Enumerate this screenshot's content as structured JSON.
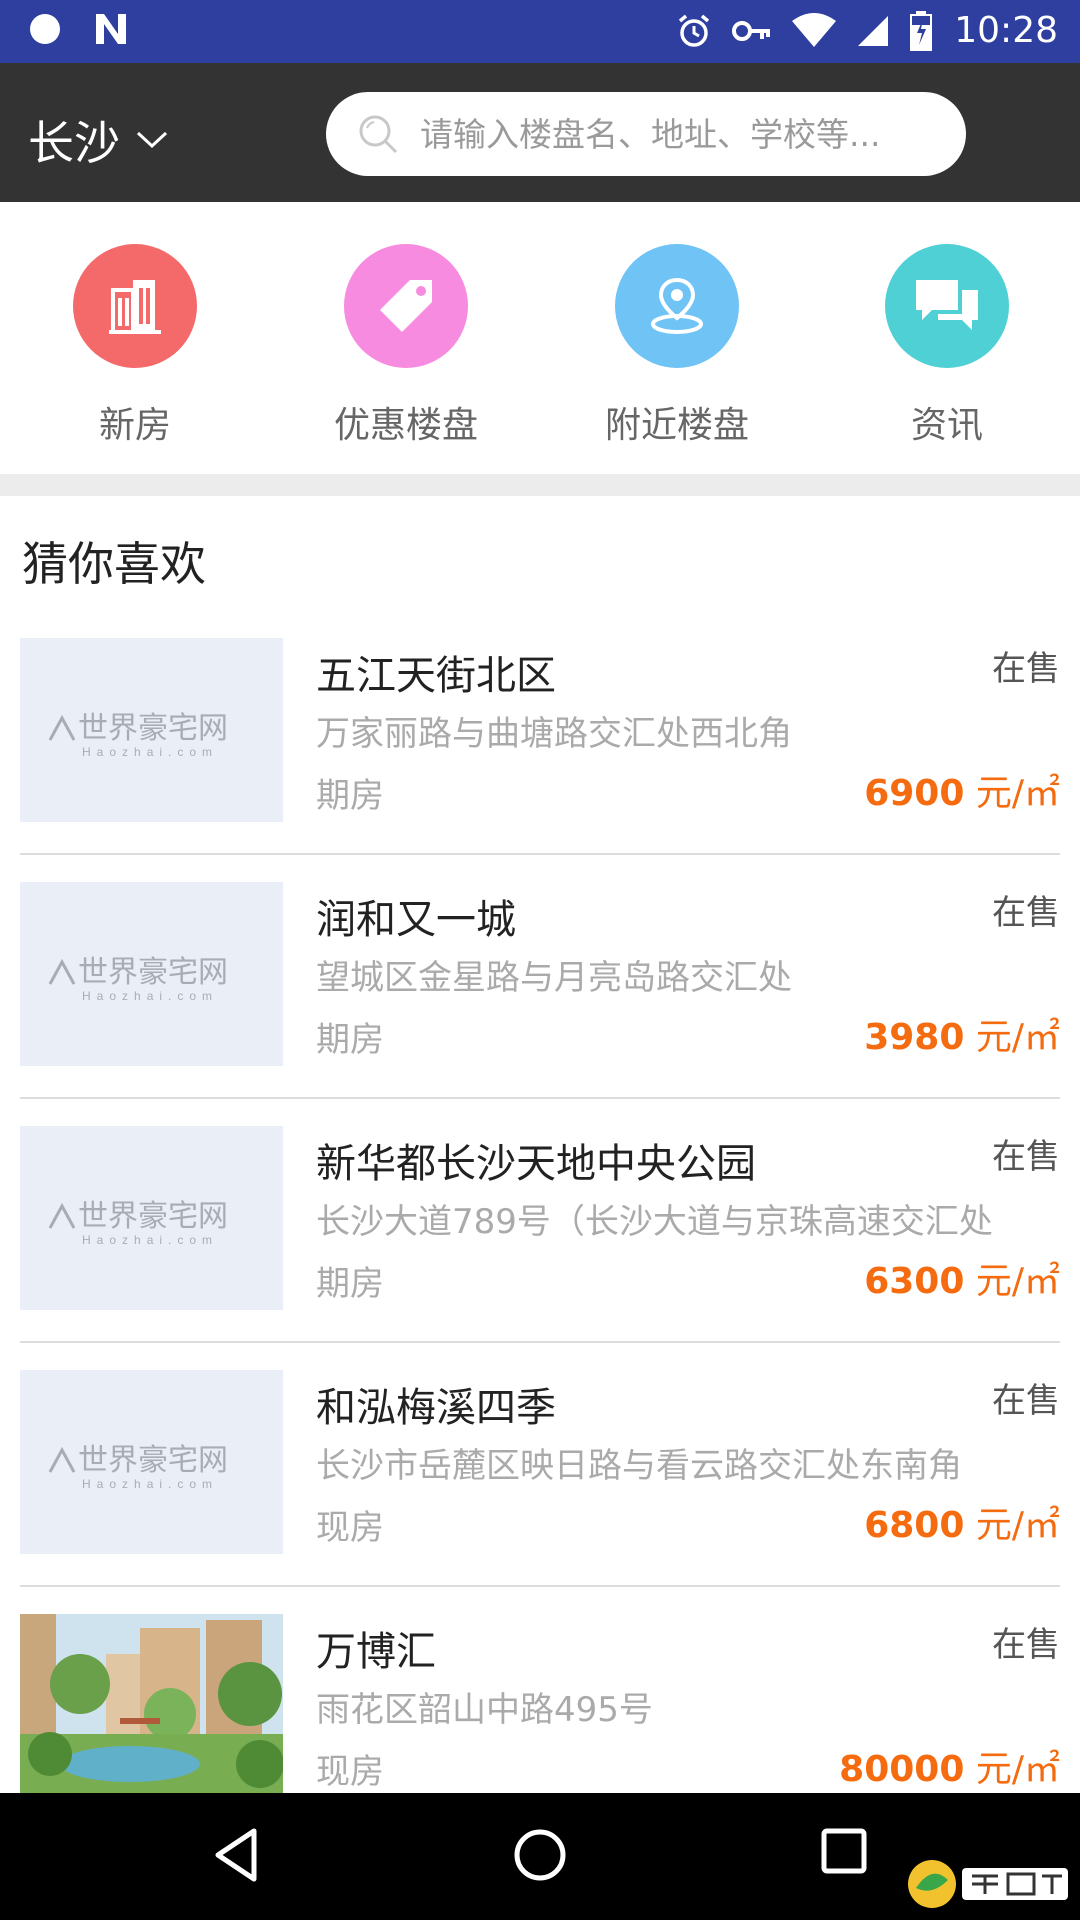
{
  "status_bar": {
    "time": "10:28"
  },
  "header": {
    "city": "长沙",
    "search_placeholder": "请输入楼盘名、地址、学校等..."
  },
  "categories": [
    {
      "label": "新房",
      "color": "#f46a6a",
      "icon": "building-icon"
    },
    {
      "label": "优惠楼盘",
      "color": "#f78be0",
      "icon": "tag-icon"
    },
    {
      "label": "附近楼盘",
      "color": "#6fc3f5",
      "icon": "location-icon"
    },
    {
      "label": "资讯",
      "color": "#4fd0d4",
      "icon": "chat-icon"
    }
  ],
  "section": {
    "title": "猜你喜欢"
  },
  "watermark": {
    "main": "世界豪宅网",
    "sub": "Haozhai.com"
  },
  "listings": [
    {
      "name": "五江天街北区",
      "status": "在售",
      "address": "万家丽路与曲塘路交汇处西北角",
      "type": "期房",
      "price": "6900",
      "unit": "元/㎡"
    },
    {
      "name": "润和又一城",
      "status": "在售",
      "address": "望城区金星路与月亮岛路交汇处",
      "type": "期房",
      "price": "3980",
      "unit": "元/㎡"
    },
    {
      "name": "新华都长沙天地中央公园",
      "status": "在售",
      "address": "长沙大道789号（长沙大道与京珠高速交汇处",
      "type": "期房",
      "price": "6300",
      "unit": "元/㎡"
    },
    {
      "name": "和泓梅溪四季",
      "status": "在售",
      "address": "长沙市岳麓区映日路与看云路交汇处东南角",
      "type": "现房",
      "price": "6800",
      "unit": "元/㎡"
    },
    {
      "name": "万博汇",
      "status": "在售",
      "address": "雨花区韶山中路495号",
      "type": "现房",
      "price": "80000",
      "unit": "元/㎡"
    }
  ],
  "colors": {
    "accent": "#f56b0f",
    "statusbar": "#2f3f9f",
    "header": "#333333"
  }
}
